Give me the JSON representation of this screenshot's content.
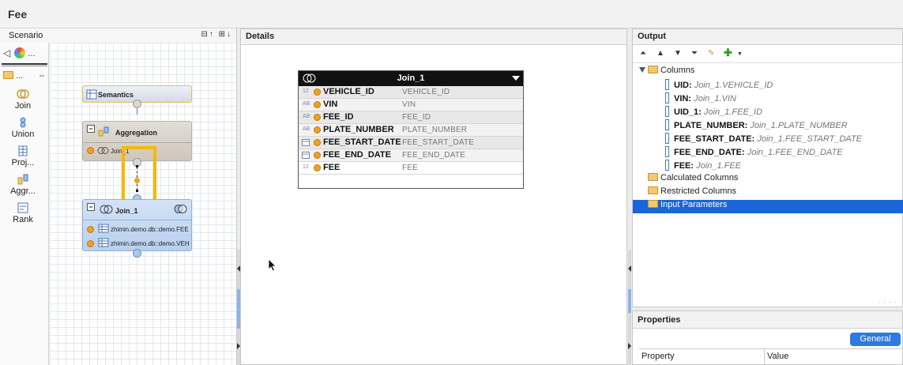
{
  "window": {
    "title": "Fee"
  },
  "scenario": {
    "title": "Scenario",
    "palette_folder_label": "...",
    "palette_items": [
      {
        "label": "Join",
        "icon": "join-icon"
      },
      {
        "label": "Union",
        "icon": "union-icon"
      },
      {
        "label": "Proj...",
        "icon": "projection-icon"
      },
      {
        "label": "Aggr...",
        "icon": "aggregation-icon"
      },
      {
        "label": "Rank",
        "icon": "rank-icon"
      }
    ],
    "nodes": {
      "semantics": {
        "label": "Semantics"
      },
      "aggregation": {
        "label": "Aggregation",
        "input": "Join_1"
      },
      "join": {
        "label": "Join_1",
        "inputs": [
          "zhimin.demo.db::demo.FEE",
          "zhimin.demo.db::demo.VEH"
        ]
      }
    },
    "highlight_color": "#f5b800"
  },
  "details": {
    "title": "Details",
    "table": {
      "title": "Join_1",
      "rows": [
        {
          "type": "12",
          "name": "VEHICLE_ID",
          "mapping": "VEHICLE_ID"
        },
        {
          "type": "AB",
          "name": "VIN",
          "mapping": "VIN"
        },
        {
          "type": "AB",
          "name": "FEE_ID",
          "mapping": "FEE_ID"
        },
        {
          "type": "AB",
          "name": "PLATE_NUMBER",
          "mapping": "PLATE_NUMBER"
        },
        {
          "type": "date",
          "name": "FEE_START_DATE",
          "mapping": "FEE_START_DATE"
        },
        {
          "type": "date",
          "name": "FEE_END_DATE",
          "mapping": "FEE_END_DATE"
        },
        {
          "type": "12",
          "name": "FEE",
          "mapping": "FEE"
        }
      ]
    }
  },
  "output": {
    "title": "Output",
    "columns_folder": "Columns",
    "columns": [
      {
        "name": "UID",
        "source": "Join_1.VEHICLE_ID"
      },
      {
        "name": "VIN",
        "source": "Join_1.VIN"
      },
      {
        "name": "UID_1",
        "source": "Join_1.FEE_ID"
      },
      {
        "name": "PLATE_NUMBER",
        "source": "Join_1.PLATE_NUMBER"
      },
      {
        "name": "FEE_START_DATE",
        "source": "Join_1.FEE_START_DATE"
      },
      {
        "name": "FEE_END_DATE",
        "source": "Join_1.FEE_END_DATE"
      },
      {
        "name": "FEE",
        "source": "Join_1.FEE"
      }
    ],
    "folders": [
      "Calculated Columns",
      "Restricted Columns",
      "Input Parameters"
    ],
    "selected_folder": "Input Parameters",
    "selection_color": "#1a66d8"
  },
  "properties": {
    "title": "Properties",
    "tab": "General",
    "col_property": "Property",
    "col_value": "Value"
  }
}
